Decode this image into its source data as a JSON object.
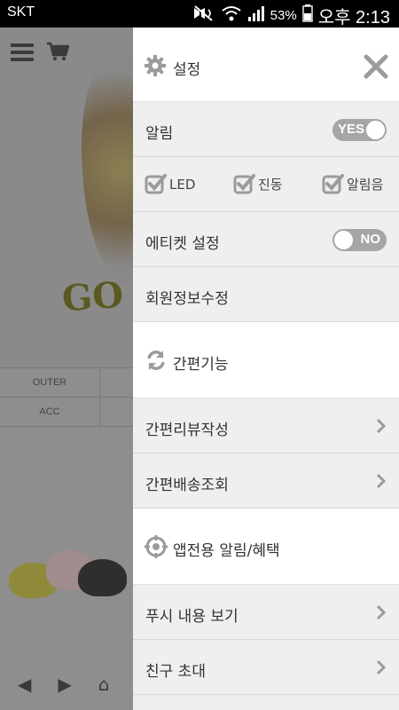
{
  "status_bar": {
    "carrier": "SKT",
    "battery_percent": "53%",
    "time": "오후 2:13"
  },
  "background_page": {
    "logo_text": "GO",
    "table": [
      {
        "col1": "OUTER",
        "col2": ""
      },
      {
        "col1": "ACC",
        "col2": ""
      }
    ]
  },
  "drawer": {
    "header": {
      "title": "설정",
      "icon": "gear-icon",
      "close_icon": "close-icon"
    },
    "notification": {
      "label": "알림",
      "toggle": "YES"
    },
    "checks": [
      {
        "label": "LED",
        "checked": true
      },
      {
        "label": "진동",
        "checked": true
      },
      {
        "label": "알림음",
        "checked": true
      }
    ],
    "etiquette": {
      "label": "에티켓 설정",
      "toggle": "NO"
    },
    "member_edit": {
      "label": "회원정보수정"
    },
    "quick_section": {
      "title": "간편기능",
      "icon": "refresh-icon"
    },
    "quick_items": [
      {
        "label": "간편리뷰작성"
      },
      {
        "label": "간편배송조회"
      }
    ],
    "app_section": {
      "title": "앱전용 알림/혜택",
      "icon": "target-icon"
    },
    "app_items": [
      {
        "label": "푸시 내용 보기"
      },
      {
        "label": "친구 초대"
      }
    ],
    "colors": {
      "accent": "#a6a6a6",
      "background": "#efefef"
    }
  }
}
